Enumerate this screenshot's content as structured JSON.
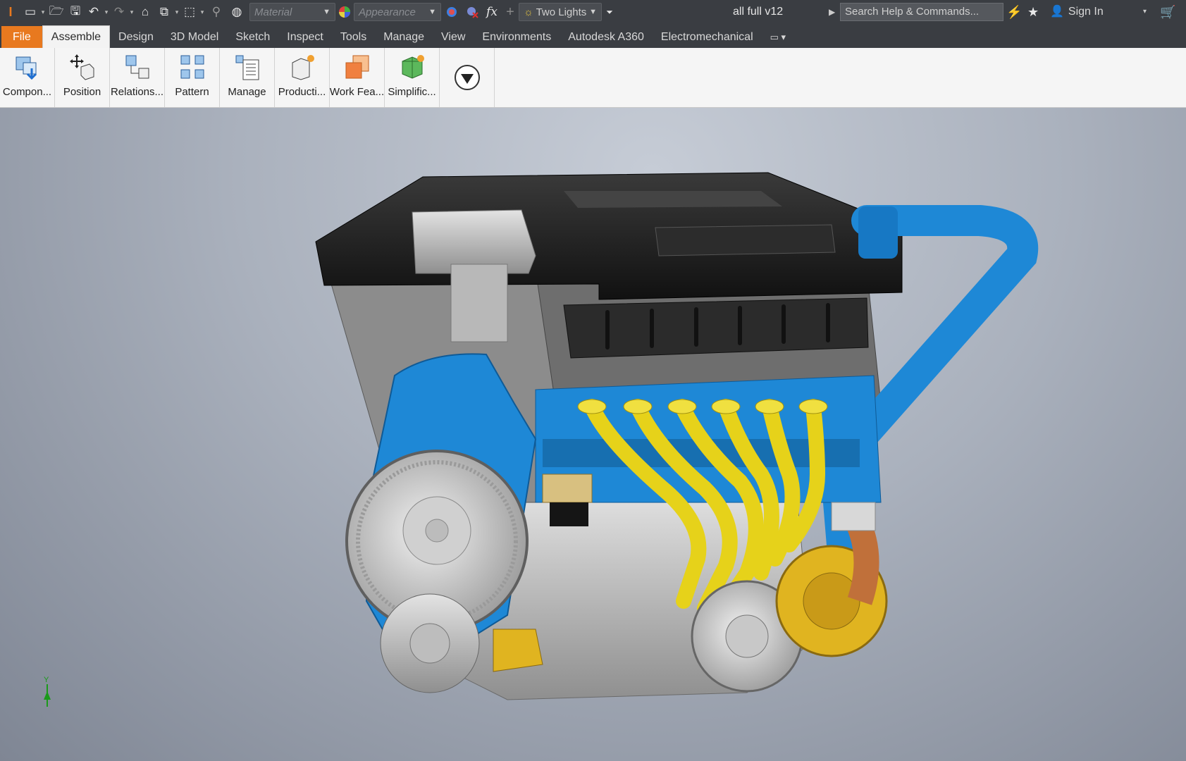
{
  "titlebar": {
    "material": "Material",
    "appearance": "Appearance",
    "lighting": "Two Lights",
    "document": "all full  v12",
    "search_placeholder": "Search Help & Commands...",
    "sign_in": "Sign In"
  },
  "menu": {
    "file": "File",
    "tabs": [
      "Assemble",
      "Design",
      "3D Model",
      "Sketch",
      "Inspect",
      "Tools",
      "Manage",
      "View",
      "Environments",
      "Autodesk A360",
      "Electromechanical"
    ]
  },
  "ribbon": {
    "buttons": [
      "Compon...",
      "Position",
      "Relations...",
      "Pattern",
      "Manage",
      "Producti...",
      "Work Fea...",
      "Simplific..."
    ]
  },
  "viewport": {
    "triad_label": "Y"
  },
  "colors": {
    "accent": "#e8791f",
    "engine_blue": "#1e88d6",
    "header_yellow": "#e6d21a",
    "cover_black": "#232323"
  }
}
